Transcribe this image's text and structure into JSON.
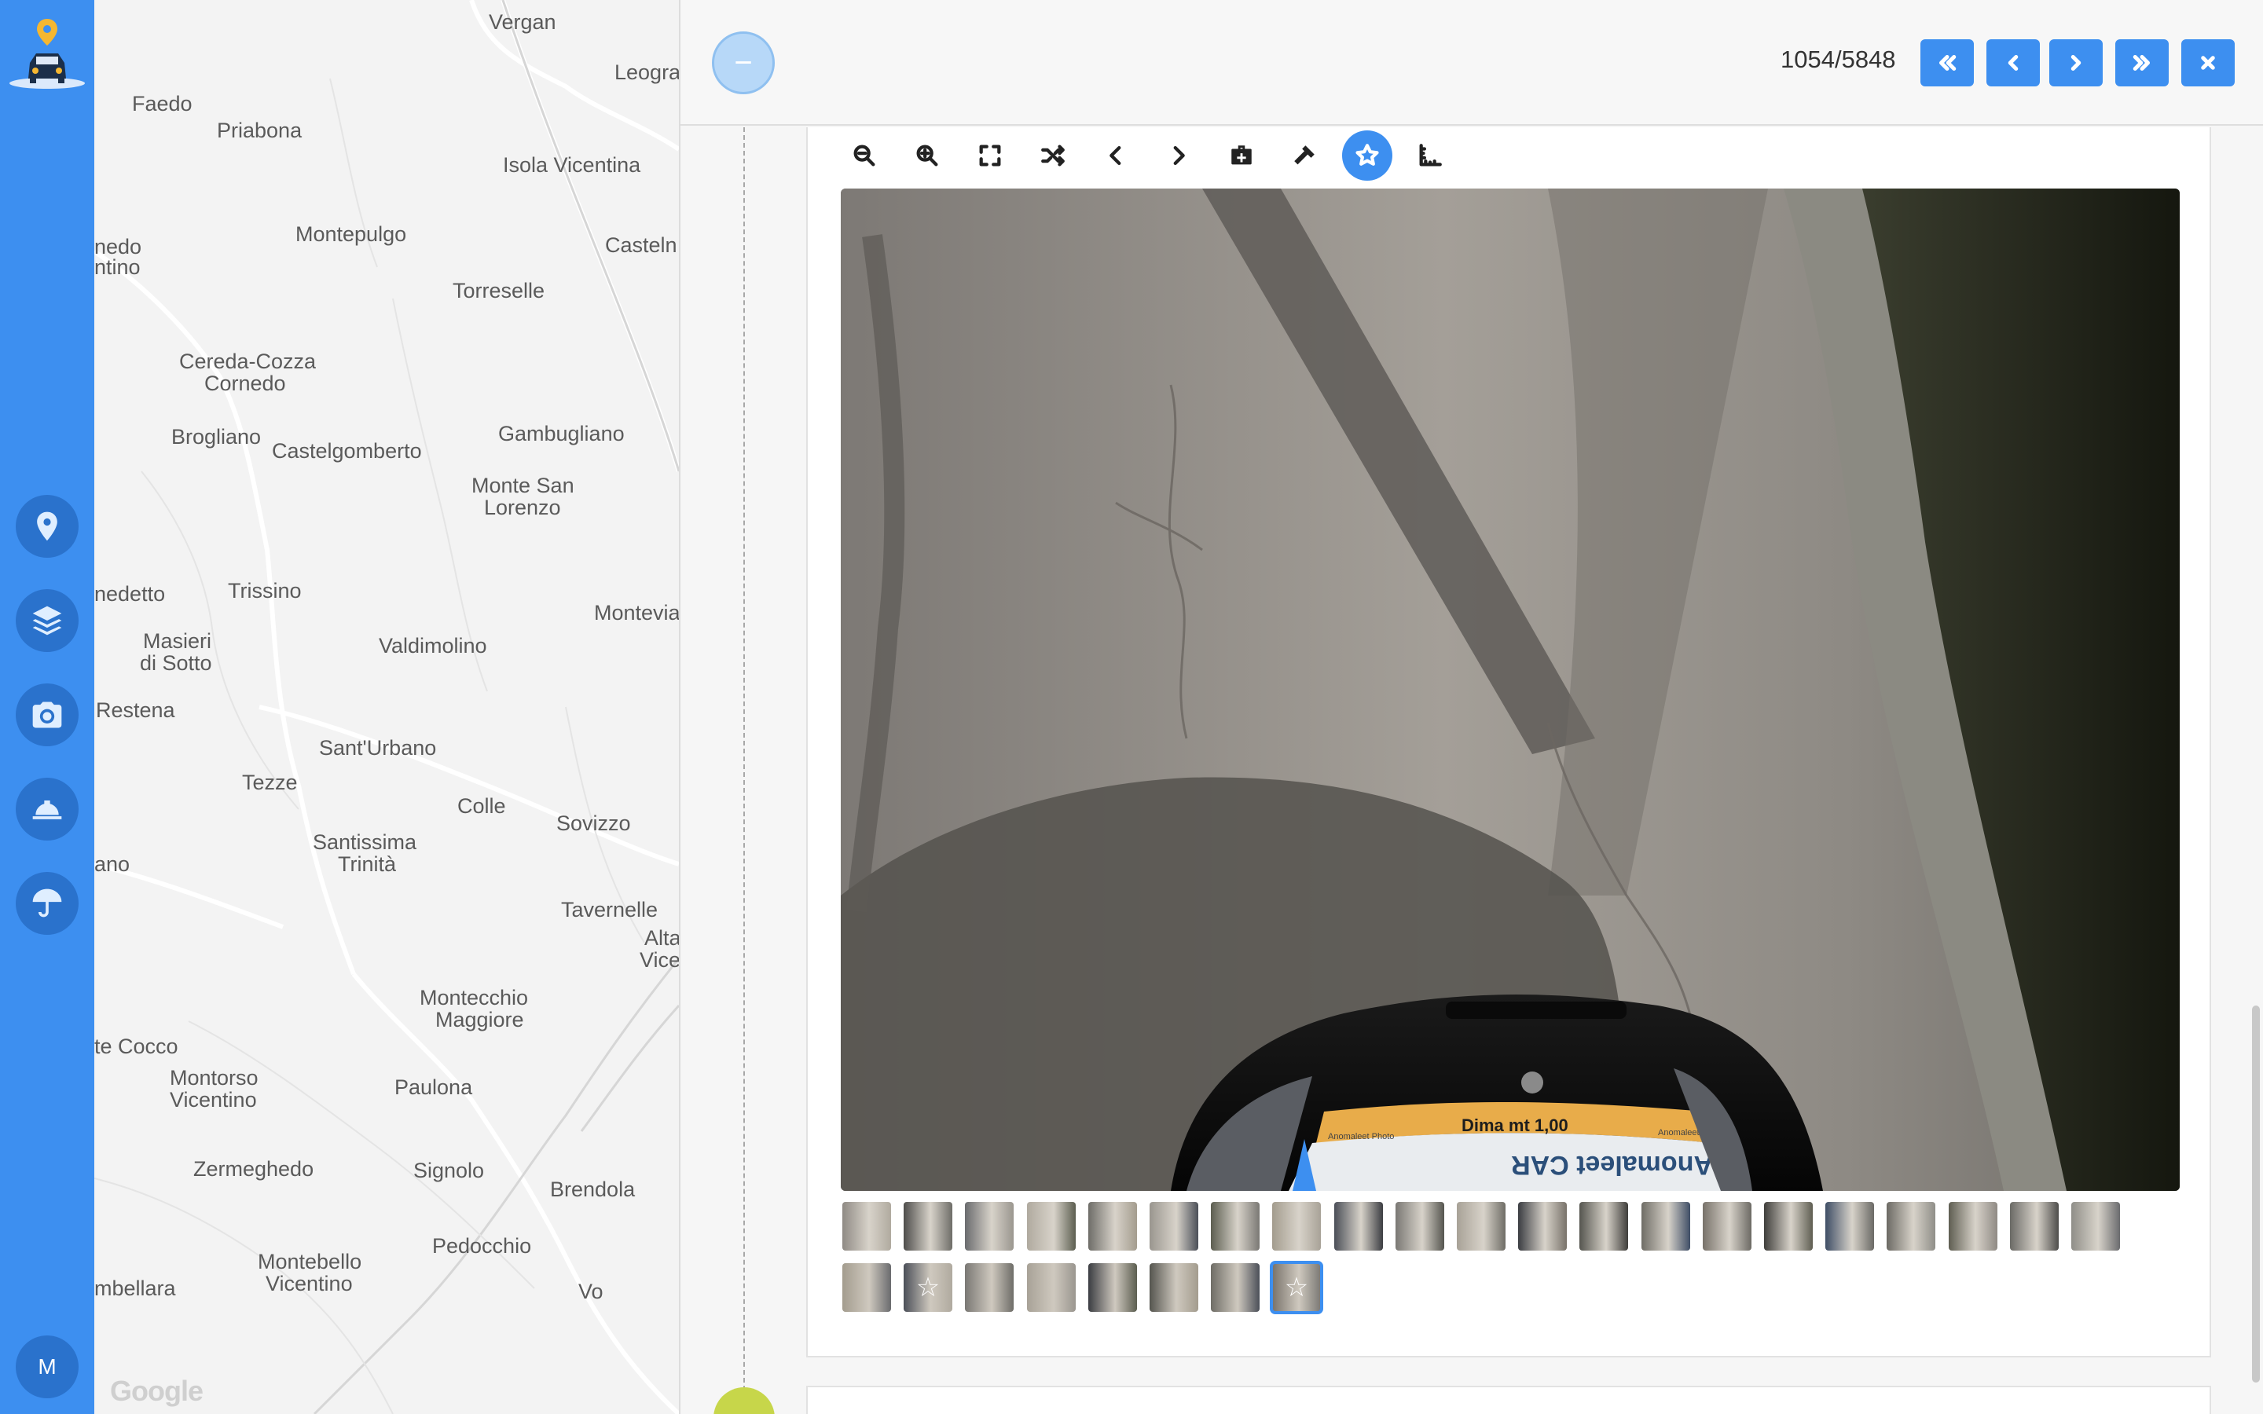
{
  "nav": {
    "user_initial": "M",
    "items": [
      "map-marker-icon",
      "layers-icon",
      "camera-icon",
      "helmet-icon",
      "umbrella-icon"
    ]
  },
  "map": {
    "attribution": "Google",
    "places": [
      "Vergan",
      "Leogra",
      "Faedo",
      "Priabona",
      "Isola Vicentina",
      "nedo",
      "ntino",
      "Montepulgo",
      "Casteln",
      "Torreselle",
      "Cereda-Cozza",
      "Cornedo",
      "Brogliano",
      "Castelgomberto",
      "Gambugliano",
      "Monte San",
      "Lorenzo",
      "nedetto",
      "Trissino",
      "Montevia",
      "Masieri",
      "di Sotto",
      "Valdimolino",
      "Restena",
      "Sant'Urbano",
      "Tezze",
      "Colle",
      "Sovizzo",
      "Santissima",
      "Trinità",
      "ano",
      "Tavernelle",
      "Alta",
      "Vice",
      "Montecchio",
      "Maggiore",
      "te Cocco",
      "Montorso",
      "Vicentino",
      "Paulona",
      "Zermeghedo",
      "Signolo",
      "Brendola",
      "Pedocchio",
      "Montebello",
      "Vicentino",
      "mbellara",
      "Vo"
    ]
  },
  "viewer": {
    "counter": "1054/5848",
    "accent": "#3d8ff0",
    "nav_buttons": [
      "first-icon",
      "prev-icon",
      "next-icon",
      "last-icon",
      "close-icon"
    ],
    "tools": [
      "zoom-out-icon",
      "zoom-in-icon",
      "fullscreen-icon",
      "shuffle-icon",
      "chevron-left-icon",
      "chevron-right-icon",
      "medkit-icon",
      "hammer-icon",
      "star-icon",
      "ruler-icon"
    ],
    "active_tool": "star-icon",
    "photo": {
      "label_top": "Dima mt 1,00",
      "label_brand": "Anomaleet CAR",
      "label_small_left": "Anomaleet Photo",
      "label_small_right": "Anomaleet Photo"
    },
    "thumbnails_row1_count": 21,
    "thumbnails_row2": [
      {
        "starred": false
      },
      {
        "starred": true
      },
      {
        "starred": false
      },
      {
        "starred": false
      },
      {
        "starred": false
      },
      {
        "starred": false
      },
      {
        "starred": false
      },
      {
        "starred": true,
        "selected": true
      }
    ]
  }
}
